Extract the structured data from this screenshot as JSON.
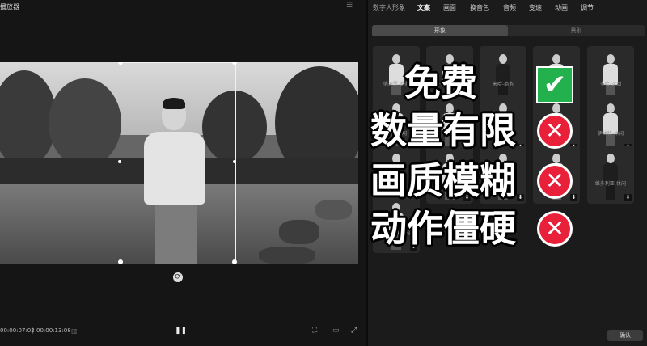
{
  "player": {
    "title": "播放器",
    "menu_icon": "menu-icon",
    "time_current": "00:00:07:02",
    "time_sep": "|",
    "time_total": "00:00:13:08"
  },
  "right_panel": {
    "tabs": [
      "数字人形象",
      "文案",
      "画面",
      "换音色",
      "音频",
      "变速",
      "动画",
      "调节"
    ],
    "subtabs": {
      "active": "形象",
      "inactive": "景别"
    },
    "cards": [
      {
        "label": "俏迪罗-商务"
      },
      {
        "label": "卡萝-商务"
      },
      {
        "label": "米哈-商务"
      },
      {
        "label": ""
      },
      {
        "label": "多哈-运动"
      },
      {
        "label": "多玛-休闲"
      },
      {
        "label": "卡米拉-休闲"
      },
      {
        "label": "格蕾丝-休闲"
      },
      {
        "label": "玛伊姆-休闲"
      },
      {
        "label": "伊丝特-休闲"
      },
      {
        "label": ""
      },
      {
        "label": ""
      },
      {
        "label": ""
      },
      {
        "label": ""
      },
      {
        "label": "维多利亚-休闲"
      },
      {
        "label": "维多利亚-休闲2"
      }
    ],
    "confirm_label": "确认"
  },
  "overlay": {
    "lines": [
      {
        "text": "免费",
        "mark": "check"
      },
      {
        "text": "数量有限",
        "mark": "x"
      },
      {
        "text": "画质模糊",
        "mark": "x"
      },
      {
        "text": "动作僵硬",
        "mark": "x"
      }
    ],
    "check_glyph": "✔",
    "x_glyph": "✕",
    "colors": {
      "check": "#22b14c",
      "x": "#e8203a"
    }
  }
}
